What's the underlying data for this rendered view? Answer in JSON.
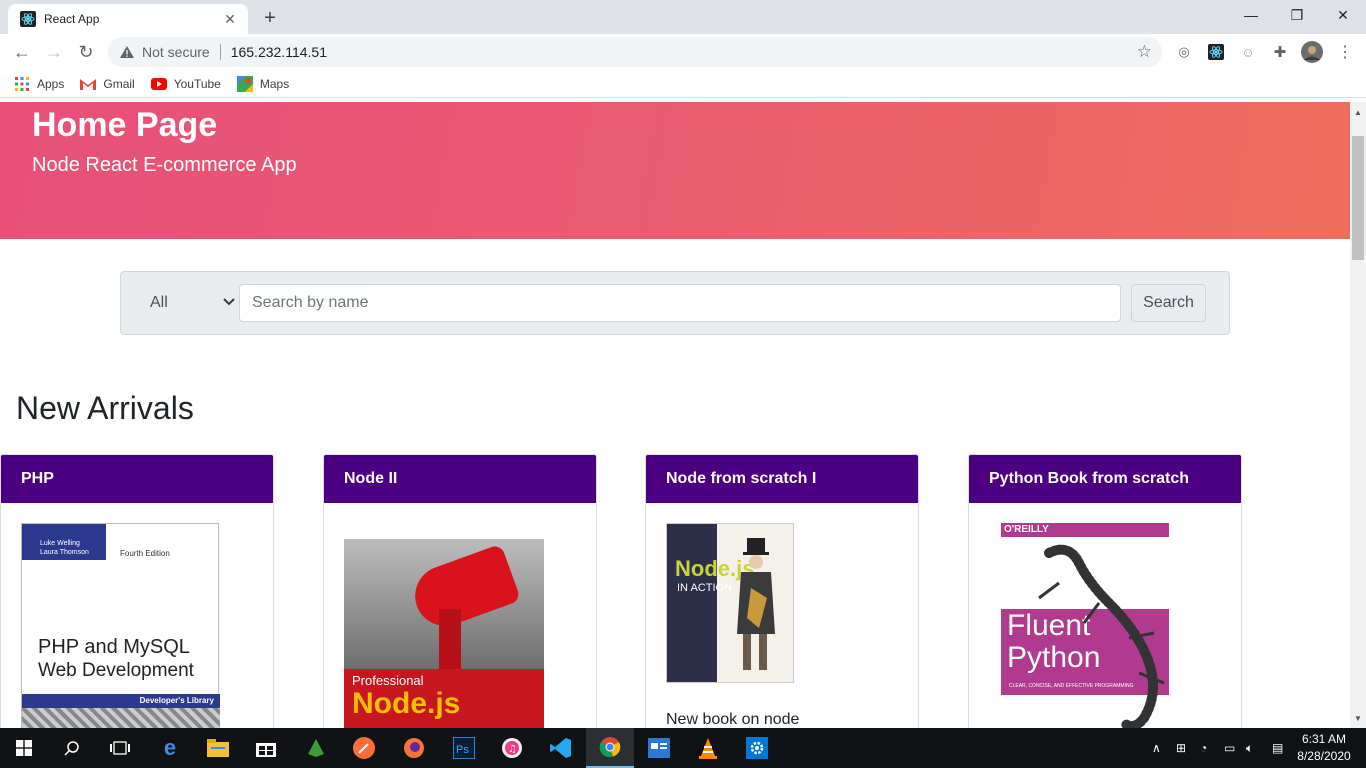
{
  "browser": {
    "tab_title": "React App",
    "security_label": "Not secure",
    "url": "165.232.114.51",
    "bookmarks": [
      {
        "label": "Apps"
      },
      {
        "label": "Gmail"
      },
      {
        "label": "YouTube"
      },
      {
        "label": "Maps"
      }
    ]
  },
  "hero": {
    "title": "Home Page",
    "subtitle": "Node React E-commerce App"
  },
  "search": {
    "category_selected": "All",
    "placeholder": "Search by name",
    "button_label": "Search"
  },
  "section_title": "New Arrivals",
  "products": [
    {
      "name": "PHP",
      "cover_line1": "PHP and MySQL",
      "cover_line2": "Web Development",
      "cover_authors": "Luke Welling\nLaura Thomson",
      "cover_edition": "Fourth Edition",
      "cover_series": "Developer's Library"
    },
    {
      "name": "Node II",
      "cover_line1": "Professional",
      "cover_line2": "Node.js"
    },
    {
      "name": "Node from scratch I",
      "cover_line1": "Node.js",
      "cover_line2": "IN ACTION",
      "description": "New book on node"
    },
    {
      "name": "Python Book from scratch",
      "cover_publisher": "O'REILLY",
      "cover_line1": "Fluent",
      "cover_line2": "Python",
      "cover_sub": "CLEAR, CONCISE, AND EFFECTIVE PROGRAMMING"
    }
  ],
  "taskbar": {
    "time": "6:31 AM",
    "date": "8/28/2020"
  },
  "colors": {
    "hero_start": "#e8507a",
    "hero_end": "#ee6e5c",
    "card_header": "#4b0082"
  }
}
